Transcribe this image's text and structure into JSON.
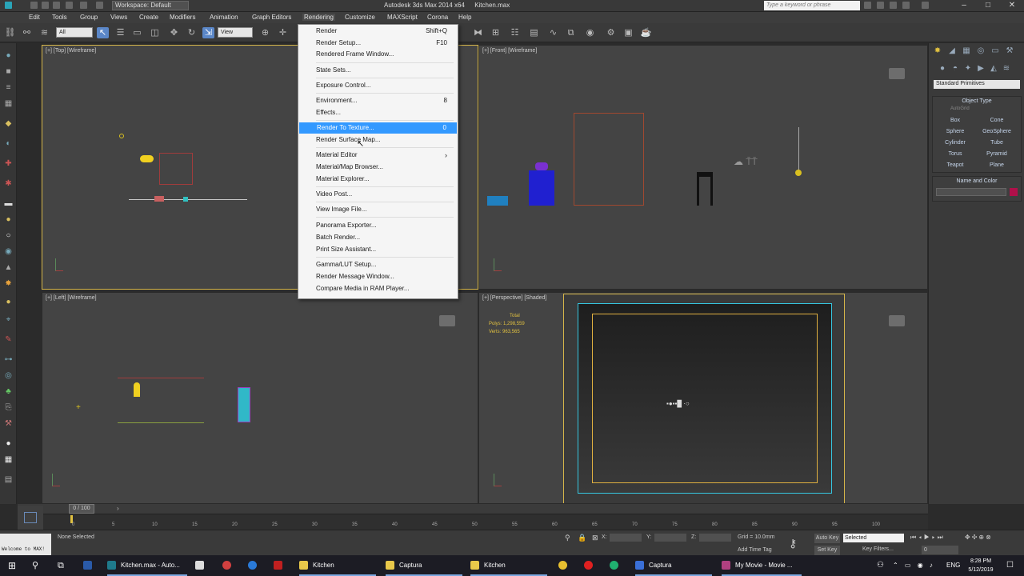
{
  "window": {
    "app_name": "Autodesk 3ds Max 2014 x64",
    "file_name": "Kitchen.max",
    "workspace": "Workspace: Default",
    "search_placeholder": "Type a keyword or phrase"
  },
  "menubar": [
    "Edit",
    "Tools",
    "Group",
    "Views",
    "Create",
    "Modifiers",
    "Animation",
    "Graph Editors",
    "Rendering",
    "Customize",
    "MAXScript",
    "Corona",
    "Help"
  ],
  "toolbar": {
    "selection_filter": "All",
    "ref_coord": "View"
  },
  "render_menu": {
    "items": [
      {
        "label": "Render",
        "shortcut": "Shift+Q"
      },
      {
        "label": "Render Setup...",
        "shortcut": "F10"
      },
      {
        "label": "Rendered Frame Window...",
        "shortcut": ""
      },
      {
        "label": "State Sets...",
        "shortcut": ""
      },
      {
        "label": "Exposure Control...",
        "shortcut": ""
      },
      {
        "label": "Environment...",
        "shortcut": "8"
      },
      {
        "label": "Effects...",
        "shortcut": ""
      },
      {
        "label": "Render To Texture...",
        "shortcut": "0"
      },
      {
        "label": "Render Surface Map...",
        "shortcut": ""
      },
      {
        "label": "Material Editor",
        "shortcut": ""
      },
      {
        "label": "Material/Map Browser...",
        "shortcut": ""
      },
      {
        "label": "Material Explorer...",
        "shortcut": ""
      },
      {
        "label": "Video Post...",
        "shortcut": ""
      },
      {
        "label": "View Image File...",
        "shortcut": ""
      },
      {
        "label": "Panorama Exporter...",
        "shortcut": ""
      },
      {
        "label": "Batch Render...",
        "shortcut": ""
      },
      {
        "label": "Print Size Assistant...",
        "shortcut": ""
      },
      {
        "label": "Gamma/LUT Setup...",
        "shortcut": ""
      },
      {
        "label": "Render Message Window...",
        "shortcut": ""
      },
      {
        "label": "Compare Media in RAM Player...",
        "shortcut": ""
      }
    ],
    "highlighted": "Render To Texture..."
  },
  "viewports": {
    "top": "[+] [Top] [Wireframe]",
    "front": "[+] [Front] [Wireframe]",
    "left": "[+] [Left] [Wireframe]",
    "perspective": "[+] [Perspective] [Shaded]"
  },
  "stats": {
    "header": "Total",
    "polys_label": "Polys:",
    "polys": "1,298,559",
    "verts_label": "Verts:",
    "verts": "963,565"
  },
  "command_panel": {
    "category": "Standard Primitives",
    "object_type_title": "Object Type",
    "autogrid": "AutoGrid",
    "primitives": [
      "Box",
      "Cone",
      "Sphere",
      "GeoSphere",
      "Cylinder",
      "Tube",
      "Torus",
      "Pyramid",
      "Teapot",
      "Plane"
    ],
    "name_color_title": "Name and Color",
    "object_color": "#b0104a"
  },
  "timeline": {
    "frame": "0 / 100",
    "ticks": [
      "0",
      "5",
      "10",
      "15",
      "20",
      "25",
      "30",
      "35",
      "40",
      "45",
      "50",
      "55",
      "60",
      "65",
      "70",
      "75",
      "80",
      "85",
      "90",
      "95",
      "100"
    ]
  },
  "status": {
    "selection": "None Selected",
    "script_prompt": "Welcome to MAX!",
    "x_label": "X:",
    "y_label": "Y:",
    "z_label": "Z:",
    "grid": "Grid = 10.0mm",
    "add_time_tag": "Add Time Tag",
    "auto_key": "Auto Key",
    "set_key": "Set Key",
    "selected": "Selected",
    "key_filters": "Key Filters...",
    "frame_field": "0"
  },
  "taskbar": {
    "apps": [
      {
        "label": "Kitchen.max - Auto...",
        "color": "#1f7a8c"
      },
      {
        "label": "Kitchen",
        "color": "#e8c84a"
      },
      {
        "label": "Captura",
        "color": "#e8c84a"
      },
      {
        "label": "Kitchen",
        "color": "#e8c84a"
      },
      {
        "label": "Captura",
        "color": "#3a6fd8"
      },
      {
        "label": "My Movie - Movie ...",
        "color": "#b04080"
      }
    ],
    "lang": "ENG",
    "time": "8:28 PM",
    "date": "5/12/2019"
  },
  "colors": {
    "highlight": "#3399ff",
    "active_viewport": "#d6b64a",
    "safe_frame": "#36c6e0",
    "render_frame": "#e0b040"
  }
}
